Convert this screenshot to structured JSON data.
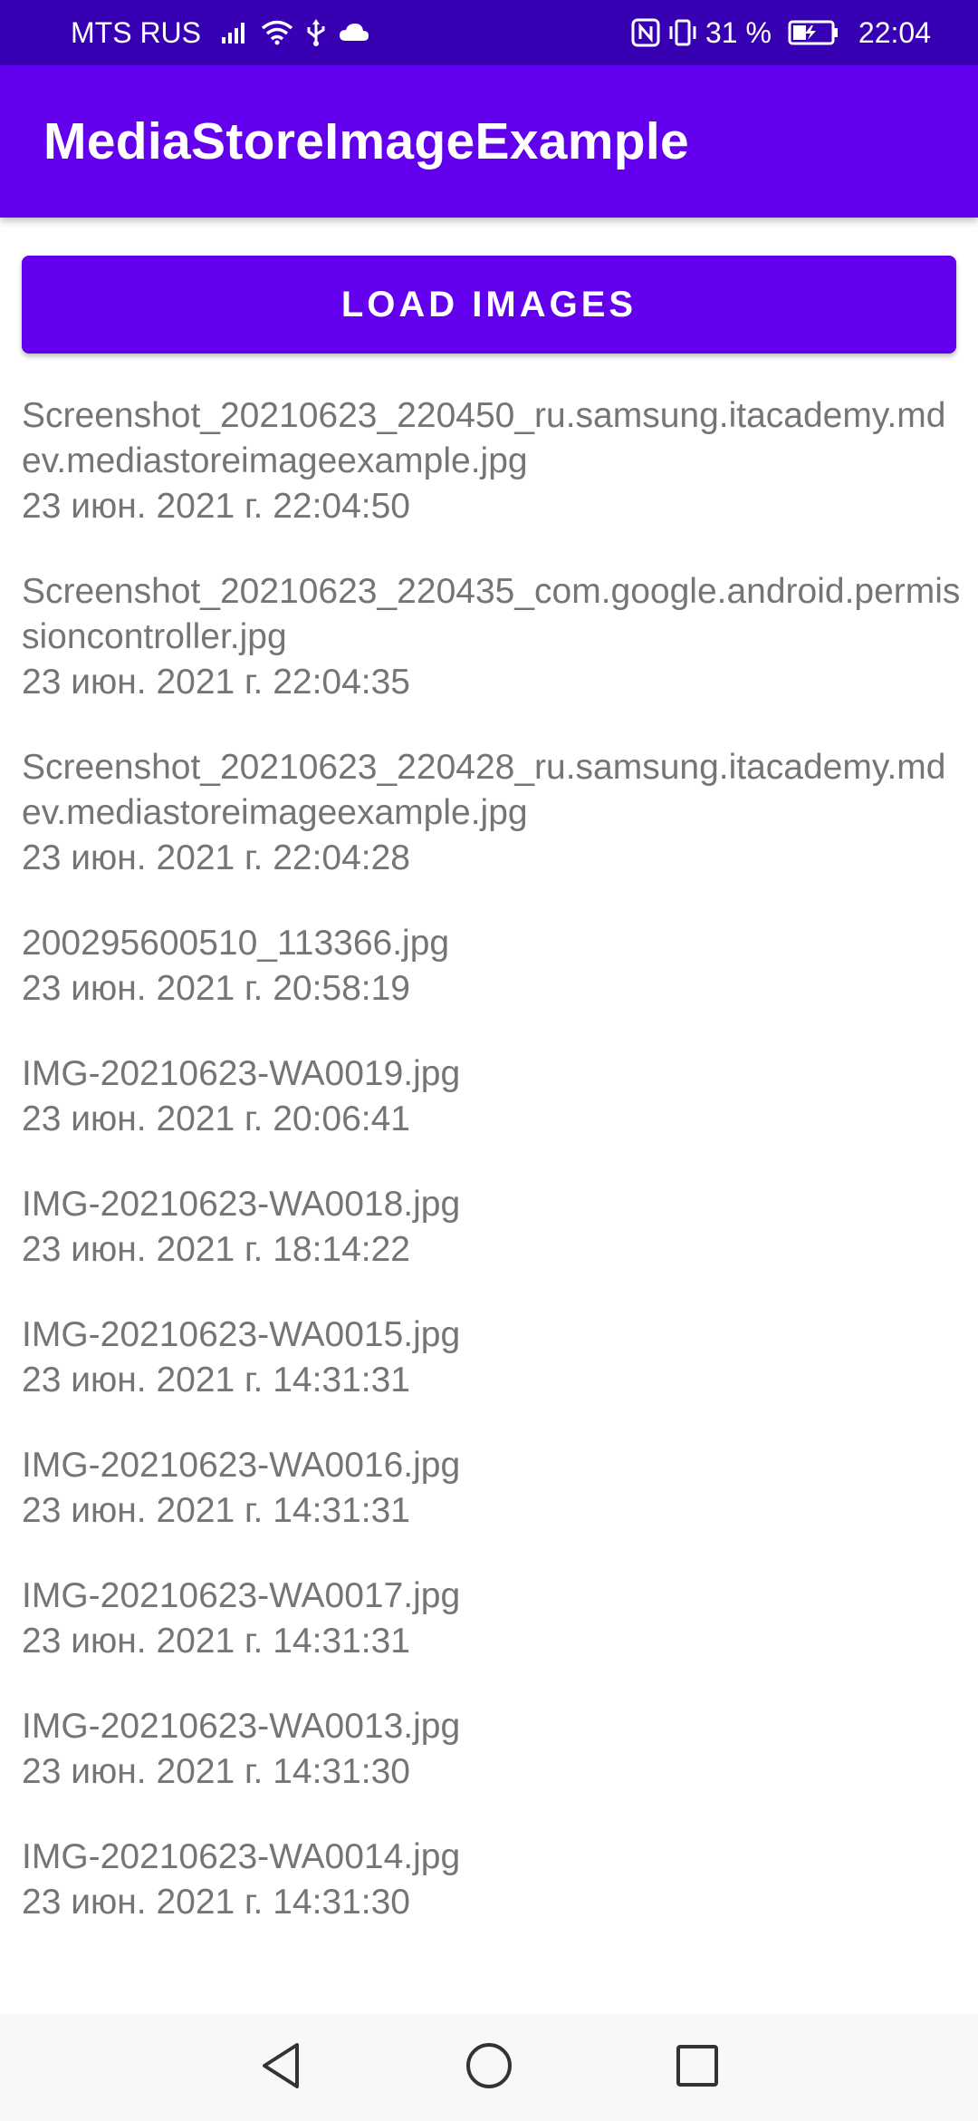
{
  "status_bar": {
    "carrier": "MTS RUS",
    "battery_percent": "31 %",
    "time": "22:04",
    "icons": [
      "signal-icon",
      "wifi-icon",
      "usb-icon",
      "cloud-icon",
      "nfc-icon",
      "vibrate-icon",
      "battery-charging-icon"
    ]
  },
  "app_bar": {
    "title": "MediaStoreImageExample"
  },
  "load_button": {
    "label": "LOAD IMAGES"
  },
  "images": [
    {
      "name": "Screenshot_20210623_220450_ru.samsung.itacademy.mdev.mediastoreimageexample.jpg",
      "date": "23 июн. 2021 г. 22:04:50"
    },
    {
      "name": "Screenshot_20210623_220435_com.google.android.permissioncontroller.jpg",
      "date": "23 июн. 2021 г. 22:04:35"
    },
    {
      "name": "Screenshot_20210623_220428_ru.samsung.itacademy.mdev.mediastoreimageexample.jpg",
      "date": "23 июн. 2021 г. 22:04:28"
    },
    {
      "name": "200295600510_113366.jpg",
      "date": "23 июн. 2021 г. 20:58:19"
    },
    {
      "name": "IMG-20210623-WA0019.jpg",
      "date": "23 июн. 2021 г. 20:06:41"
    },
    {
      "name": "IMG-20210623-WA0018.jpg",
      "date": "23 июн. 2021 г. 18:14:22"
    },
    {
      "name": "IMG-20210623-WA0015.jpg",
      "date": "23 июн. 2021 г. 14:31:31"
    },
    {
      "name": "IMG-20210623-WA0016.jpg",
      "date": "23 июн. 2021 г. 14:31:31"
    },
    {
      "name": "IMG-20210623-WA0017.jpg",
      "date": "23 июн. 2021 г. 14:31:31"
    },
    {
      "name": "IMG-20210623-WA0013.jpg",
      "date": "23 июн. 2021 г. 14:31:30"
    },
    {
      "name": "IMG-20210623-WA0014.jpg",
      "date": "23 июн. 2021 г. 14:31:30"
    }
  ],
  "nav_bar": {
    "icons": [
      "back-icon",
      "home-icon",
      "recents-icon"
    ]
  },
  "colors": {
    "status_bar": "#3700b3",
    "primary": "#6200ee",
    "text_secondary": "#757575"
  }
}
